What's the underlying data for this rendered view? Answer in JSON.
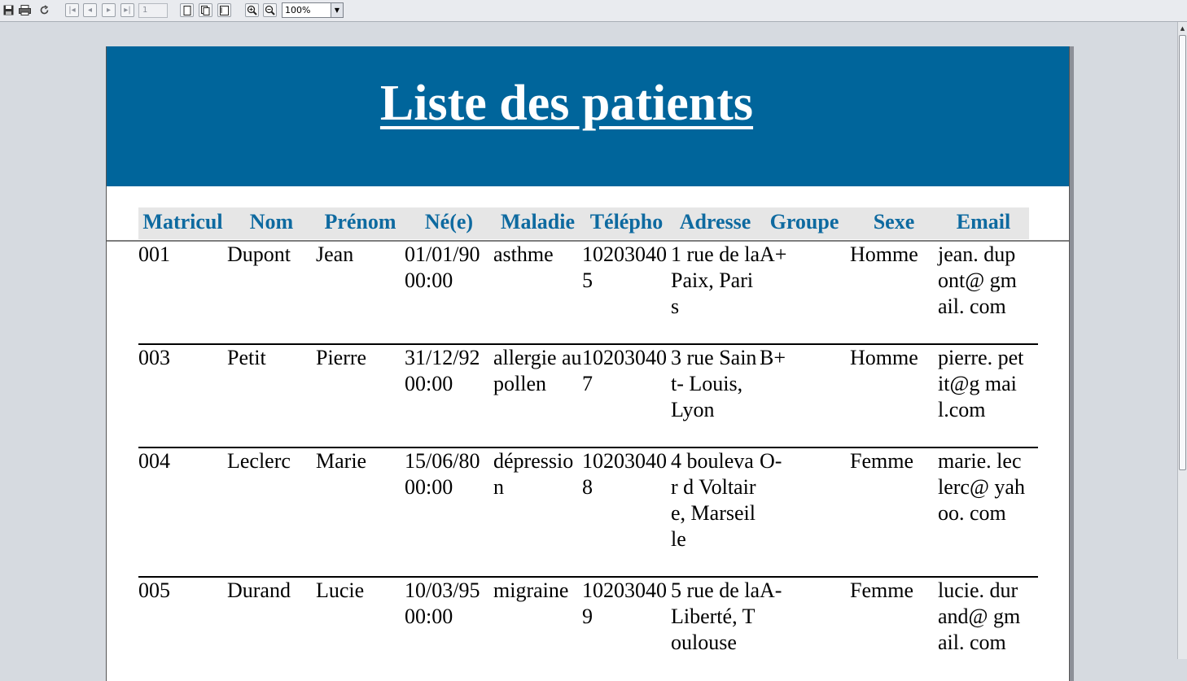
{
  "toolbar": {
    "page_number": "1",
    "zoom_value": "100%",
    "icons": [
      "save-icon",
      "print-icon",
      "reload-icon",
      "first-page-icon",
      "prev-page-icon",
      "next-page-icon",
      "last-page-icon",
      "single-page-icon",
      "continuous-page-icon",
      "facing-page-icon",
      "zoom-in-icon",
      "zoom-out-icon",
      "dropdown-arrow-icon"
    ]
  },
  "report": {
    "title": "Liste des patients",
    "header_bg": "#00659b",
    "header_text_color": "#0e6aa0",
    "columns": [
      "Matricul",
      "Nom",
      "Prénom",
      "Né(e)",
      "Maladie",
      "Télépho",
      "Adresse",
      "Groupe",
      "Sexe",
      "Email"
    ],
    "rows": [
      {
        "matricule": "001",
        "nom": "Dupont",
        "prenom": "Jean",
        "ne": "01/01/90 00:00",
        "maladie": "asthme",
        "telephone": "102030405",
        "adresse": "1 rue de la Paix, Paris",
        "groupe": "A+",
        "sexe": "Homme",
        "email": "jean. dupont@ gmail. com"
      },
      {
        "matricule": "003",
        "nom": "Petit",
        "prenom": "Pierre",
        "ne": "31/12/92 00:00",
        "maladie": "allergie au pollen",
        "telephone": "102030407",
        "adresse": "3 rue Saint- Louis, Lyon",
        "groupe": "B+",
        "sexe": "Homme",
        "email": "pierre. petit@g mail.com"
      },
      {
        "matricule": "004",
        "nom": "Leclerc",
        "prenom": "Marie",
        "ne": "15/06/80 00:00",
        "maladie": "dépressio n",
        "telephone": "102030408",
        "adresse": "4 boulevar d Voltaire, Marseille",
        "groupe": "O-",
        "sexe": "Femme",
        "email": "marie. leclerc@ yahoo. com"
      },
      {
        "matricule": "005",
        "nom": "Durand",
        "prenom": "Lucie",
        "ne": "10/03/95 00:00",
        "maladie": "migraine",
        "telephone": "102030409",
        "adresse": "5 rue de la Liberté, Toulouse",
        "groupe": "A-",
        "sexe": "Femme",
        "email": "lucie. durand@ gmail. com"
      }
    ]
  }
}
